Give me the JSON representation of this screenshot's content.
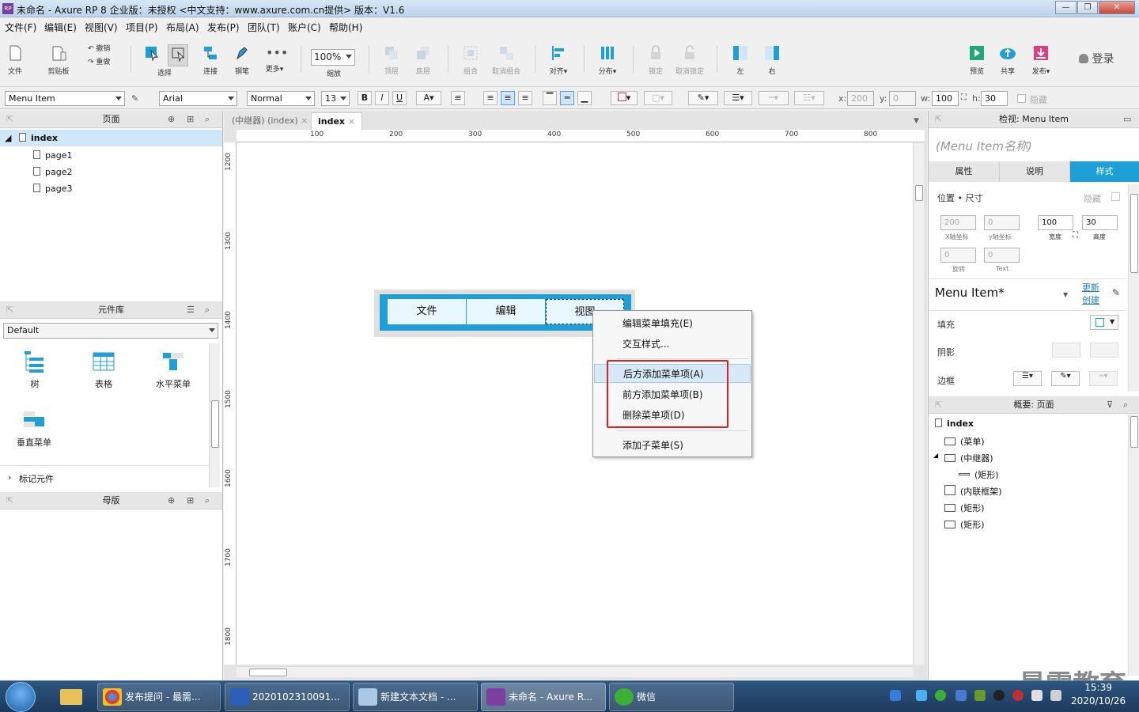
{
  "window": {
    "title": "未命名 - Axure RP 8 企业版：未授权      <中文支持：www.axure.com.cn提供> 版本：V1.6",
    "app_icon": "RP",
    "controls": [
      "—",
      "❐",
      "✕"
    ]
  },
  "menubar": [
    "文件(F)",
    "编辑(E)",
    "视图(V)",
    "项目(P)",
    "布局(A)",
    "发布(P)",
    "团队(T)",
    "账户(C)",
    "帮助(H)"
  ],
  "toolbar": {
    "file": "文件",
    "clipboard": "剪贴板",
    "undo": "撤销",
    "redo": "重做",
    "select": "选择",
    "connect": "连接",
    "pen": "钢笔",
    "more": "更多▾",
    "zoom_value": "100%",
    "zoom": "缩放",
    "top": "顶层",
    "bottom": "底层",
    "group": "组合",
    "ungroup": "取消组合",
    "align": "对齐▾",
    "distribute": "分布▾",
    "lock": "锁定",
    "unlock": "取消锁定",
    "left": "左",
    "right": "右",
    "preview": "预览",
    "share": "共享",
    "publish": "发布▾",
    "login": "登录"
  },
  "formatbar": {
    "widget_style": "Menu Item",
    "font": "Arial",
    "weight": "Normal",
    "size": "13",
    "bold": "B",
    "italic": "I",
    "underline": "U",
    "x_label": "x:",
    "x": "200",
    "y_label": "y:",
    "y": "0",
    "w_label": "w:",
    "w": "100",
    "h_label": "h:",
    "h": "30",
    "hidden": "隐藏"
  },
  "pages_panel": {
    "title": "页面",
    "root": "index",
    "pages": [
      "page1",
      "page2",
      "page3"
    ]
  },
  "library_panel": {
    "title": "元件库",
    "selected_library": "Default",
    "widgets": [
      "树",
      "表格",
      "水平菜单",
      "垂直菜单"
    ],
    "marker": "标记元件"
  },
  "masters_panel": {
    "title": "母版"
  },
  "tabs": [
    "(中继器) (index)",
    "index"
  ],
  "rulers": {
    "h": [
      "100",
      "200",
      "300",
      "400",
      "500",
      "600",
      "700",
      "800"
    ],
    "v": [
      "1200",
      "1300",
      "1400",
      "1500",
      "1600",
      "1700",
      "1800"
    ]
  },
  "menu_widget": [
    "文件",
    "编辑",
    "视图"
  ],
  "context_menu": {
    "edit_fill": "编辑菜单填充(E)",
    "interaction_style": "交互样式...",
    "add_after": "后方添加菜单项(A)",
    "add_before": "前方添加菜单项(B)",
    "delete": "删除菜单项(D)",
    "add_submenu": "添加子菜单(S)"
  },
  "inspector": {
    "title": "检视: Menu Item",
    "name_placeholder": "(Menu Item名称)",
    "tabs": [
      "属性",
      "说明",
      "样式"
    ],
    "pos_size": "位置 • 尺寸",
    "hidden": "隐藏",
    "x": "200",
    "y": "0",
    "w": "100",
    "h": "30",
    "x_sub": "X轴坐标",
    "y_sub": "y轴坐标",
    "w_sub": "宽度",
    "h_sub": "高度",
    "rotate": "0",
    "text_rotate": "0",
    "rotate_sub": "旋转",
    "text_sub": "Text",
    "style_name": "Menu Item*",
    "update": "更新",
    "create": "创建",
    "fill": "填充",
    "shadow": "阴影",
    "border": "边框"
  },
  "outline": {
    "title": "概要: 页面",
    "root": "index",
    "items": [
      "(菜单)",
      "(中继器)",
      "(矩形)",
      "(内联框架)",
      "(矩形)",
      "(矩形)"
    ]
  },
  "taskbar": {
    "tasks": [
      "发布提问 - 最需...",
      "2020102310091...",
      "新建文本文档 - ...",
      "未命名 - Axure R...",
      "微信"
    ],
    "time": "15:39",
    "date": "2020/10/26"
  },
  "watermark": "最需教育",
  "colors": {
    "accent": "#1e9fd8",
    "highlight_box": "#e02020"
  }
}
